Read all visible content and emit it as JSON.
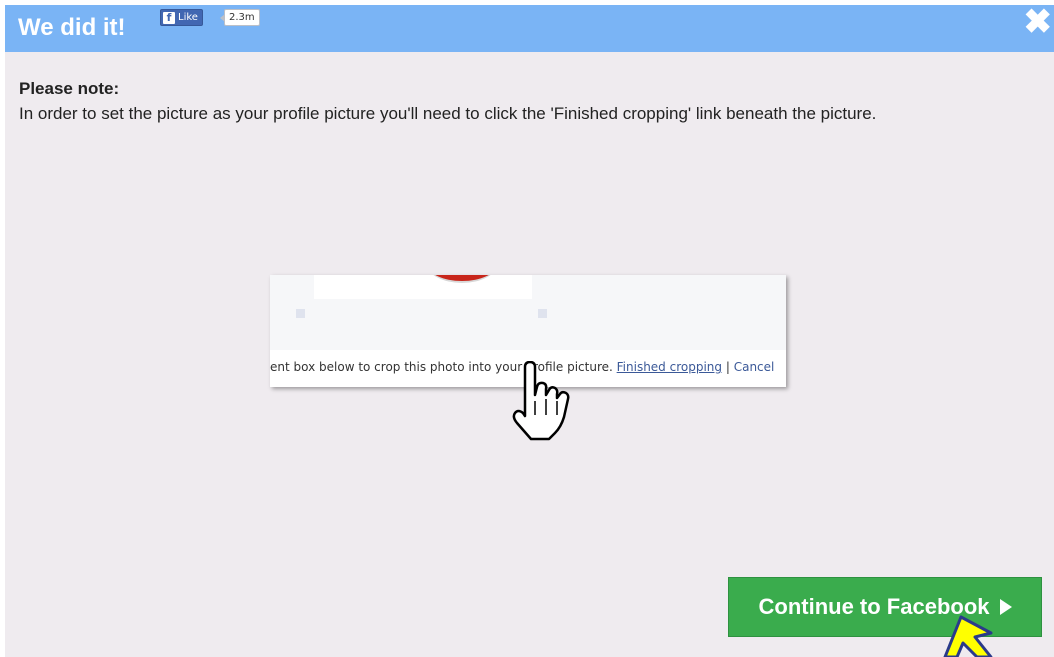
{
  "dialog": {
    "title": "We did it!",
    "close_icon": "close-x-icon"
  },
  "facebook_like": {
    "label": "Like",
    "count": "2.3m",
    "icon": "facebook-f-icon"
  },
  "note": {
    "heading": "Please note:",
    "text": "In order to set the picture as your profile picture you'll need to click the 'Finished cropping' link beneath the picture."
  },
  "crop_screenshot": {
    "instruction_prefix": "ent box below to crop this photo into your Profile picture.",
    "finished_link": "Finished cropping",
    "separator": "|",
    "cancel_link": "Cancel"
  },
  "continue_button": {
    "label": "Continue to Facebook"
  },
  "colors": {
    "titlebar": "#7ab4f5",
    "background": "#efebef",
    "button_green": "#3aac4d",
    "facebook_blue": "#4267b2",
    "pointer_yellow": "#ffff00",
    "pointer_outline": "#2a3a8a"
  }
}
